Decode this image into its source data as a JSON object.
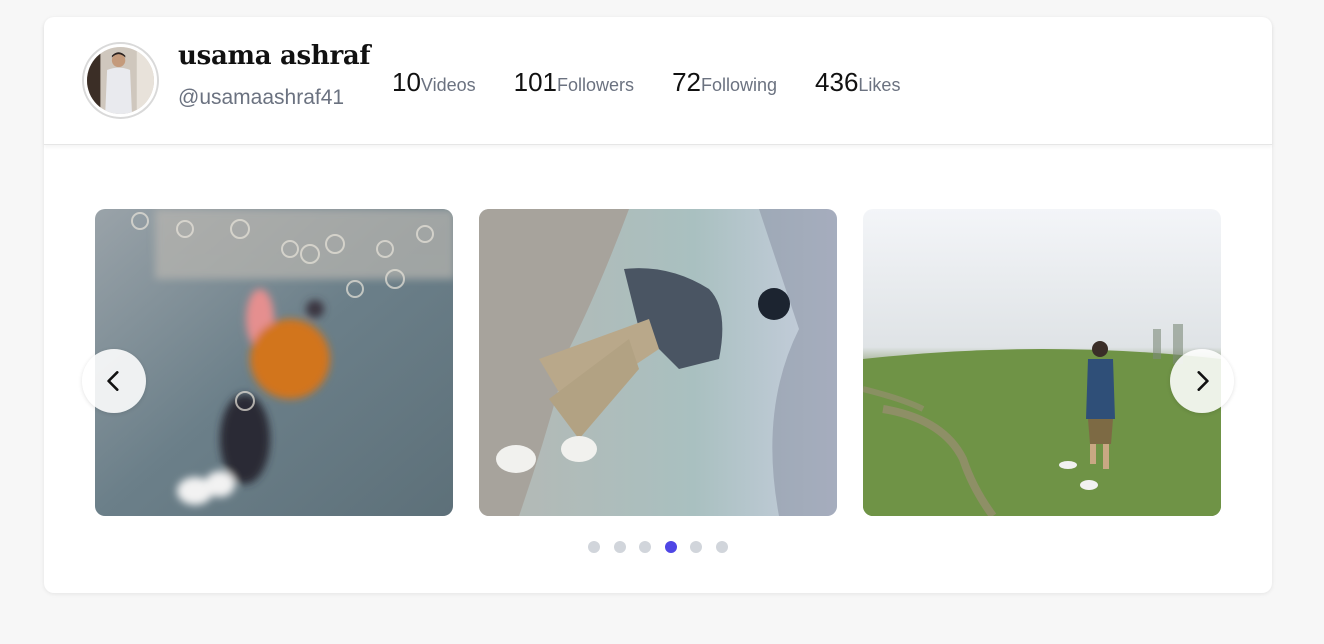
{
  "profile": {
    "name": "usama ashraf",
    "handle": "@usamaashraf41",
    "avatar_icon": "profile-photo"
  },
  "stats": [
    {
      "value": "10",
      "label": "Videos"
    },
    {
      "value": "101",
      "label": "Followers"
    },
    {
      "value": "72",
      "label": "Following"
    },
    {
      "value": "436",
      "label": "Likes"
    }
  ],
  "carousel": {
    "slides": [
      {
        "name": "blurred-motion-video-thumbnail"
      },
      {
        "name": "man-sitting-on-rock-video-thumbnail"
      },
      {
        "name": "man-standing-in-foggy-meadow-video-thumbnail"
      }
    ],
    "prev_icon": "chevron-left-icon",
    "next_icon": "chevron-right-icon",
    "dot_count": 6,
    "active_dot": 4
  },
  "colors": {
    "accent": "#4f46e5",
    "dot_inactive": "#d1d5db",
    "text_muted": "#6b7280"
  }
}
